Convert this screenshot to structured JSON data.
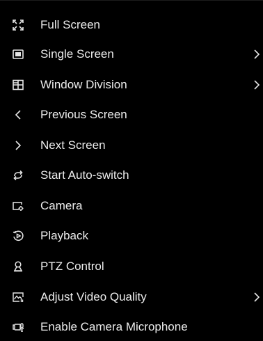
{
  "menu": {
    "colors": {
      "background": "#000000",
      "text": "#ececec"
    },
    "items": [
      {
        "label": "Full Screen",
        "icon": "fullscreen-icon",
        "has_submenu": false
      },
      {
        "label": "Single Screen",
        "icon": "single-screen-icon",
        "has_submenu": true
      },
      {
        "label": "Window Division",
        "icon": "window-division-icon",
        "has_submenu": true
      },
      {
        "label": "Previous Screen",
        "icon": "chevron-left-icon",
        "has_submenu": false
      },
      {
        "label": "Next Screen",
        "icon": "chevron-right-icon",
        "has_submenu": false
      },
      {
        "label": "Start Auto-switch",
        "icon": "auto-switch-icon",
        "has_submenu": false
      },
      {
        "label": "Camera",
        "icon": "camera-settings-icon",
        "has_submenu": false
      },
      {
        "label": "Playback",
        "icon": "playback-icon",
        "has_submenu": false
      },
      {
        "label": "PTZ Control",
        "icon": "ptz-control-icon",
        "has_submenu": false
      },
      {
        "label": "Adjust Video Quality",
        "icon": "video-quality-icon",
        "has_submenu": true
      },
      {
        "label": "Enable Camera Microphone",
        "icon": "camera-microphone-icon",
        "has_submenu": false
      }
    ]
  }
}
